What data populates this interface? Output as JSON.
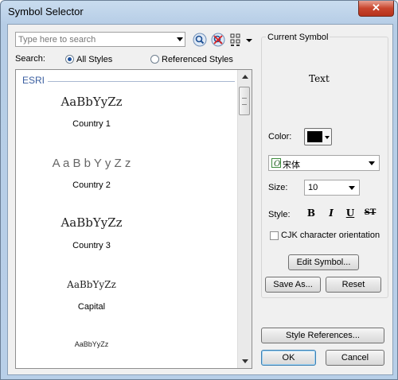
{
  "window": {
    "title": "Symbol Selector",
    "close_glyph": "✕"
  },
  "search": {
    "placeholder": "Type here to search",
    "label": "Search:",
    "scope_all": "All Styles",
    "scope_referenced": "Referenced Styles",
    "selected_scope": "All Styles"
  },
  "list": {
    "group": "ESRI",
    "items": [
      {
        "sample": "AaBbYyZz",
        "name": "Country 1"
      },
      {
        "sample": "A a B b Y y Z z",
        "name": "Country 2"
      },
      {
        "sample": "AaBbYyZz",
        "name": "Country 3"
      },
      {
        "sample": "AaBbYyZz",
        "name": "Capital"
      },
      {
        "sample": "AaBbYyZz",
        "name": ""
      }
    ]
  },
  "current_symbol": {
    "title": "Current Symbol",
    "preview_text": "Text",
    "color_label": "Color:",
    "color_value": "#000000",
    "font_value": "宋体",
    "size_label": "Size:",
    "size_value": "10",
    "style_label": "Style:",
    "style_buttons": [
      "B",
      "I",
      "U",
      "ST"
    ],
    "cjk_label": "CJK character orientation",
    "cjk_checked": false,
    "edit_button": "Edit Symbol...",
    "save_as_button": "Save As...",
    "reset_button": "Reset"
  },
  "footer": {
    "style_references_button": "Style References...",
    "ok_button": "OK",
    "cancel_button": "Cancel"
  },
  "icons": [
    "search-icon",
    "clear-search-icon",
    "view-options-icon",
    "font-type-icon"
  ]
}
